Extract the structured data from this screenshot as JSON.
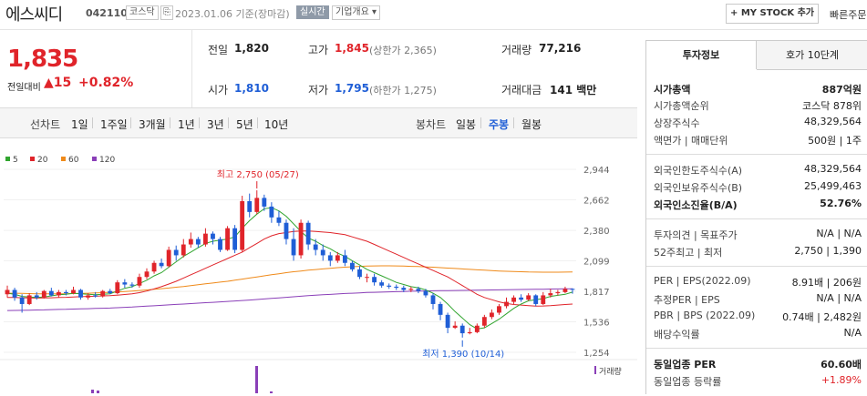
{
  "header": {
    "name": "에스씨디",
    "code": "042110",
    "market": "코스닥",
    "date": "2023.01.06  기준(장마감)",
    "realtime": "실시간",
    "company_info": "기업개요",
    "mystock": "+ MY STOCK 추가",
    "quick_order": "빠른주문"
  },
  "quote": {
    "price": "1,835",
    "change_label": "전일대비",
    "change": "▲15",
    "change_pct": "+0.82%",
    "prev_close_label": "전일",
    "prev_close": "1,820",
    "high_label": "고가",
    "high": "1,845",
    "upper_limit": "(상한가 2,365)",
    "volume_label": "거래량",
    "volume": "77,216",
    "open_label": "시가",
    "open": "1,810",
    "low_label": "저가",
    "low": "1,795",
    "lower_limit": "(하한가 1,275)",
    "amount_label": "거래대금",
    "amount": "141 백만"
  },
  "chart_tabs": {
    "line_label": "선차트",
    "periods": [
      "1일",
      "1주일",
      "3개월",
      "1년",
      "3년",
      "5년",
      "10년"
    ],
    "candle_label": "봉차트",
    "candles": [
      "일봉",
      "주봉",
      "월봉"
    ],
    "active_candle": "주봉"
  },
  "colors": {
    "up": "#e0242a",
    "down": "#1f5ed6",
    "ma5": "#31a52f",
    "ma20": "#e0242a",
    "ma60": "#ef8a1a",
    "ma120": "#8a3fb8"
  },
  "chart_data": {
    "type": "candlestick",
    "legend": [
      {
        "name": "5",
        "color": "#31a52f"
      },
      {
        "name": "20",
        "color": "#e0242a"
      },
      {
        "name": "60",
        "color": "#ef8a1a"
      },
      {
        "name": "120",
        "color": "#8a3fb8"
      }
    ],
    "y_ticks": [
      "2,944",
      "2,662",
      "2,380",
      "2,099",
      "1,817",
      "1,536",
      "1,254"
    ],
    "ylim": [
      1254,
      2944
    ],
    "volume_label": "거래량",
    "max_annotation": "최고 2,750 (05/27)",
    "min_annotation": "최저 1,390 (10/14)",
    "candles": [
      [
        1790,
        1830,
        1760,
        1870
      ],
      [
        1830,
        1760,
        1730,
        1850
      ],
      [
        1760,
        1700,
        1620,
        1790
      ],
      [
        1700,
        1780,
        1690,
        1800
      ],
      [
        1780,
        1760,
        1740,
        1810
      ],
      [
        1760,
        1820,
        1750,
        1830
      ],
      [
        1820,
        1780,
        1770,
        1850
      ],
      [
        1780,
        1810,
        1760,
        1830
      ],
      [
        1810,
        1800,
        1780,
        1830
      ],
      [
        1800,
        1830,
        1790,
        1860
      ],
      [
        1830,
        1760,
        1740,
        1840
      ],
      [
        1760,
        1780,
        1740,
        1800
      ],
      [
        1780,
        1770,
        1760,
        1810
      ],
      [
        1770,
        1820,
        1760,
        1830
      ],
      [
        1820,
        1800,
        1790,
        1840
      ],
      [
        1800,
        1900,
        1790,
        1920
      ],
      [
        1900,
        1880,
        1850,
        1930
      ],
      [
        1880,
        1870,
        1850,
        1900
      ],
      [
        1870,
        1950,
        1850,
        1980
      ],
      [
        1950,
        2000,
        1930,
        2030
      ],
      [
        2000,
        2080,
        1980,
        2100
      ],
      [
        2080,
        2050,
        2030,
        2120
      ],
      [
        2050,
        2200,
        2040,
        2230
      ],
      [
        2200,
        2150,
        2100,
        2240
      ],
      [
        2150,
        2250,
        2130,
        2300
      ],
      [
        2250,
        2300,
        2220,
        2360
      ],
      [
        2300,
        2250,
        2220,
        2320
      ],
      [
        2250,
        2350,
        2230,
        2400
      ],
      [
        2350,
        2300,
        2250,
        2370
      ],
      [
        2300,
        2200,
        2180,
        2320
      ],
      [
        2200,
        2400,
        2190,
        2420
      ],
      [
        2400,
        2200,
        2170,
        2430
      ],
      [
        2200,
        2650,
        2180,
        2700
      ],
      [
        2650,
        2550,
        2500,
        2720
      ],
      [
        2550,
        2680,
        2530,
        2750
      ],
      [
        2680,
        2600,
        2560,
        2710
      ],
      [
        2600,
        2500,
        2450,
        2640
      ],
      [
        2500,
        2450,
        2420,
        2560
      ],
      [
        2450,
        2300,
        2250,
        2480
      ],
      [
        2300,
        2150,
        2100,
        2400
      ],
      [
        2150,
        2450,
        2120,
        2480
      ],
      [
        2450,
        2250,
        2200,
        2470
      ],
      [
        2250,
        2200,
        2150,
        2300
      ],
      [
        2200,
        2150,
        2100,
        2250
      ],
      [
        2150,
        2100,
        2050,
        2180
      ],
      [
        2100,
        2150,
        2080,
        2180
      ],
      [
        2150,
        2080,
        2050,
        2200
      ],
      [
        2080,
        2020,
        2000,
        2100
      ],
      [
        2020,
        1950,
        1930,
        2050
      ],
      [
        1950,
        1950,
        1900,
        1980
      ],
      [
        1950,
        1900,
        1870,
        1980
      ],
      [
        1900,
        1870,
        1850,
        1920
      ],
      [
        1870,
        1860,
        1840,
        1890
      ],
      [
        1860,
        1850,
        1830,
        1880
      ],
      [
        1850,
        1830,
        1810,
        1870
      ],
      [
        1830,
        1840,
        1810,
        1860
      ],
      [
        1840,
        1820,
        1800,
        1860
      ],
      [
        1820,
        1780,
        1760,
        1840
      ],
      [
        1780,
        1700,
        1650,
        1800
      ],
      [
        1700,
        1600,
        1550,
        1720
      ],
      [
        1600,
        1480,
        1430,
        1620
      ],
      [
        1480,
        1500,
        1470,
        1540
      ],
      [
        1500,
        1430,
        1390,
        1520
      ],
      [
        1430,
        1440,
        1420,
        1480
      ],
      [
        1440,
        1500,
        1430,
        1520
      ],
      [
        1500,
        1580,
        1480,
        1600
      ],
      [
        1580,
        1620,
        1560,
        1650
      ],
      [
        1620,
        1680,
        1600,
        1700
      ],
      [
        1680,
        1720,
        1660,
        1760
      ],
      [
        1720,
        1760,
        1700,
        1780
      ],
      [
        1760,
        1740,
        1720,
        1790
      ],
      [
        1740,
        1780,
        1730,
        1800
      ],
      [
        1780,
        1700,
        1680,
        1790
      ],
      [
        1700,
        1780,
        1690,
        1810
      ],
      [
        1780,
        1800,
        1760,
        1840
      ],
      [
        1800,
        1810,
        1780,
        1830
      ],
      [
        1810,
        1840,
        1800,
        1860
      ],
      [
        1840,
        1835,
        1795,
        1845
      ]
    ],
    "ma5": [
      1800,
      1790,
      1770,
      1765,
      1760,
      1765,
      1775,
      1785,
      1790,
      1800,
      1795,
      1790,
      1785,
      1790,
      1795,
      1820,
      1845,
      1860,
      1890,
      1920,
      1960,
      1990,
      2040,
      2090,
      2140,
      2180,
      2220,
      2260,
      2280,
      2290,
      2300,
      2320,
      2400,
      2470,
      2530,
      2580,
      2590,
      2560,
      2510,
      2440,
      2370,
      2310,
      2280,
      2240,
      2210,
      2170,
      2140,
      2100,
      2060,
      2020,
      1990,
      1960,
      1930,
      1900,
      1880,
      1860,
      1850,
      1830,
      1800,
      1760,
      1700,
      1630,
      1570,
      1510,
      1470,
      1480,
      1520,
      1560,
      1610,
      1660,
      1700,
      1730,
      1740,
      1750,
      1770,
      1780,
      1790,
      1810
    ],
    "ma20": [
      1760,
      1760,
      1758,
      1756,
      1755,
      1756,
      1758,
      1760,
      1762,
      1765,
      1768,
      1770,
      1772,
      1775,
      1778,
      1782,
      1788,
      1795,
      1805,
      1820,
      1840,
      1860,
      1885,
      1910,
      1940,
      1970,
      2000,
      2030,
      2060,
      2090,
      2120,
      2150,
      2180,
      2220,
      2260,
      2300,
      2330,
      2350,
      2360,
      2370,
      2375,
      2375,
      2370,
      2365,
      2360,
      2350,
      2340,
      2320,
      2300,
      2280,
      2250,
      2220,
      2190,
      2160,
      2130,
      2100,
      2070,
      2040,
      2010,
      1980,
      1950,
      1910,
      1870,
      1830,
      1790,
      1760,
      1740,
      1720,
      1705,
      1695,
      1690,
      1685,
      1680,
      1682,
      1685,
      1690,
      1695,
      1700
    ],
    "ma60": [
      1800,
      1800,
      1798,
      1796,
      1795,
      1794,
      1794,
      1794,
      1795,
      1796,
      1798,
      1800,
      1802,
      1805,
      1808,
      1812,
      1816,
      1820,
      1825,
      1830,
      1836,
      1842,
      1848,
      1855,
      1862,
      1870,
      1878,
      1886,
      1894,
      1902,
      1910,
      1920,
      1930,
      1940,
      1950,
      1960,
      1970,
      1980,
      1990,
      1998,
      2005,
      2012,
      2018,
      2024,
      2030,
      2036,
      2040,
      2044,
      2048,
      2050,
      2052,
      2053,
      2053,
      2052,
      2050,
      2048,
      2046,
      2043,
      2040,
      2036,
      2032,
      2028,
      2024,
      2020,
      2016,
      2012,
      2008,
      2005,
      2002,
      2000,
      1998,
      1996,
      1995,
      1994,
      1994,
      1994,
      1995,
      1996
    ],
    "ma120": [
      1640,
      1641,
      1642,
      1643,
      1645,
      1646,
      1648,
      1650,
      1651,
      1653,
      1655,
      1657,
      1659,
      1661,
      1663,
      1666,
      1669,
      1672,
      1676,
      1680,
      1684,
      1688,
      1692,
      1696,
      1700,
      1704,
      1708,
      1712,
      1716,
      1720,
      1724,
      1728,
      1732,
      1737,
      1742,
      1747,
      1752,
      1757,
      1762,
      1767,
      1772,
      1777,
      1781,
      1785,
      1789,
      1793,
      1797,
      1800,
      1803,
      1806,
      1808,
      1810,
      1812,
      1814,
      1816,
      1818,
      1820,
      1821,
      1822,
      1823,
      1824,
      1825,
      1826,
      1827,
      1828,
      1829,
      1830,
      1831,
      1832,
      1833,
      1834,
      1835,
      1836,
      1837,
      1838,
      1839,
      1840,
      1841
    ]
  },
  "side_panel": {
    "tabs": [
      "투자정보",
      "호가 10단계"
    ],
    "rows": [
      {
        "label": "시가총액",
        "value": "887억원",
        "bold": true
      },
      {
        "label": "시가총액순위",
        "value": "코스닥 878위"
      },
      {
        "label": "상장주식수",
        "value": "48,329,564"
      },
      {
        "label": "액면가 | 매매단위",
        "value": "500원 | 1주"
      },
      {
        "label": "외국인한도주식수(A)",
        "value": "48,329,564"
      },
      {
        "label": "외국인보유주식수(B)",
        "value": "25,499,463"
      },
      {
        "label": "외국인소진율(B/A)",
        "value": "52.76%",
        "bold": true
      },
      {
        "label": "투자의견 | 목표주가",
        "value": "N/A | N/A"
      },
      {
        "label": "52주최고 | 최저",
        "value": "2,750 | 1,390"
      },
      {
        "label": "PER | EPS(2022.09)",
        "value": "8.91배 | 206원"
      },
      {
        "label": "추정PER | EPS",
        "value": "N/A | N/A"
      },
      {
        "label": "PBR | BPS (2022.09)",
        "value": "0.74배 | 2,482원"
      },
      {
        "label": "배당수익률",
        "value": "N/A"
      },
      {
        "label": "동일업종 PER",
        "value": "60.60배",
        "bold": true
      },
      {
        "label": "동일업종 등락률",
        "value": "+1.89%",
        "red": true
      }
    ]
  }
}
